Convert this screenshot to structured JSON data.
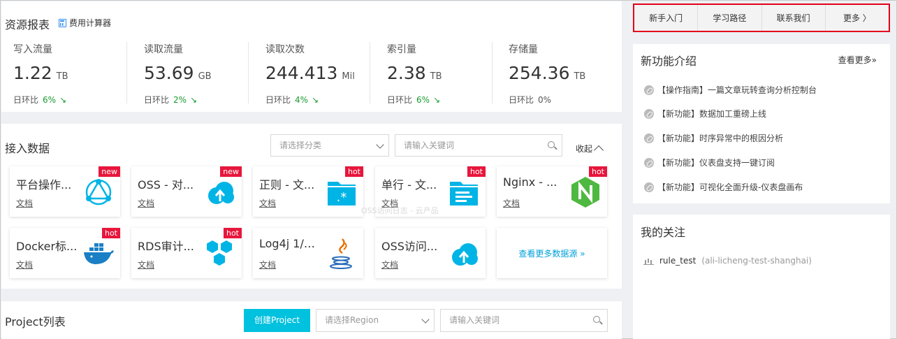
{
  "report": {
    "title": "资源报表",
    "calculator": "费用计算器",
    "metrics": [
      {
        "label": "写入流量",
        "value": "1.22",
        "unit": "TB",
        "change_label": "日环比",
        "change": "6%",
        "trend": "down"
      },
      {
        "label": "读取流量",
        "value": "53.69",
        "unit": "GB",
        "change_label": "日环比",
        "change": "2%",
        "trend": "down"
      },
      {
        "label": "读取次数",
        "value": "244.413",
        "unit": "Mil",
        "change_label": "日环比",
        "change": "4%",
        "trend": "down"
      },
      {
        "label": "索引量",
        "value": "2.38",
        "unit": "TB",
        "change_label": "日环比",
        "change": "6%",
        "trend": "down"
      },
      {
        "label": "存储量",
        "value": "254.36",
        "unit": "TB",
        "change_label": "日环比",
        "change": "0%",
        "trend": "none"
      }
    ],
    "trend_arrow": "↘"
  },
  "access": {
    "title": "接入数据",
    "category_placeholder": "请选择分类",
    "search_placeholder": "请输入关键词",
    "collapse": "收起",
    "tiles": [
      {
        "name": "平台操作...",
        "doc": "文档",
        "badge": "new",
        "icon": "platform-icon"
      },
      {
        "name": "OSS - 对...",
        "doc": "文档",
        "badge": "new",
        "icon": "cloud-upload-icon"
      },
      {
        "name": "正则 - 文...",
        "doc": "文档",
        "badge": "hot",
        "icon": "folder-regex-icon"
      },
      {
        "name": "单行 - 文...",
        "doc": "文档",
        "badge": "hot",
        "icon": "folder-lines-icon"
      },
      {
        "name": "Nginx - ...",
        "doc": "文档",
        "badge": "hot",
        "icon": "nginx-icon"
      },
      {
        "name": "Docker标...",
        "doc": "文档",
        "badge": "hot",
        "icon": "docker-icon"
      },
      {
        "name": "RDS审计...",
        "doc": "文档",
        "badge": "hot",
        "icon": "hexagons-icon"
      },
      {
        "name": "Log4j 1/2...",
        "doc": "文档",
        "badge": "",
        "icon": "java-icon"
      },
      {
        "name": "OSS访问...",
        "doc": "文档",
        "badge": "",
        "icon": "cloud-upload-icon"
      }
    ],
    "more_sources": "查看更多数据源 »",
    "watermark": "OSS访问日志 - 云产品"
  },
  "project": {
    "title": "Project列表",
    "create_button": "创建Project",
    "region_placeholder": "请选择Region",
    "search_placeholder": "请输入关键词"
  },
  "topnav": {
    "items": [
      "新手入门",
      "学习路径",
      "联系我们",
      "更多 〉"
    ]
  },
  "features": {
    "title": "新功能介绍",
    "see_more": "查看更多»",
    "items": [
      "【操作指南】一篇文章玩转查询分析控制台",
      "【新功能】数据加工重磅上线",
      "【新功能】时序异常中的根因分析",
      "【新功能】仪表盘支持一键订阅",
      "【新功能】可视化全面升级-仪表盘画布"
    ]
  },
  "follow": {
    "title": "我的关注",
    "item_name": "rule_test",
    "item_sub": "(ali-licheng-test-shanghai)"
  },
  "colors": {
    "accent": "#00c1de",
    "badge": "#e8163c",
    "trend_green": "#1a9b2f",
    "highlight_border": "#e2001a"
  }
}
